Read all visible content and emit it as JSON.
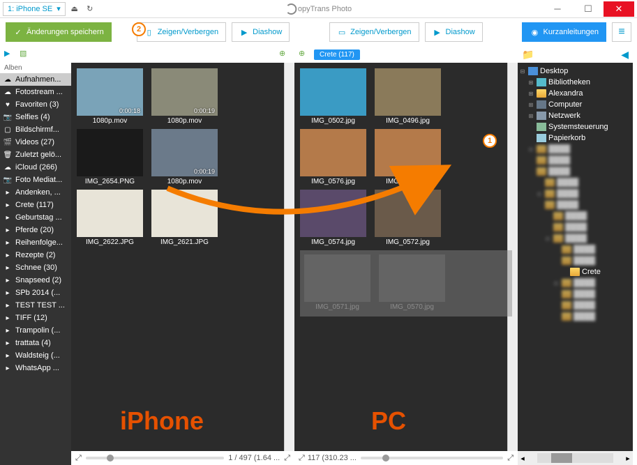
{
  "titlebar": {
    "device": "1: iPhone SE",
    "app_name": "opyTrans Photo"
  },
  "toolbar": {
    "save": "Änderungen speichern",
    "left_show": "Zeigen/Verbergen",
    "left_slide": "Diashow",
    "right_show": "Zeigen/Verbergen",
    "right_slide": "Diashow",
    "help": "Kurzanleitungen"
  },
  "sidebar": {
    "title": "Alben",
    "items": [
      {
        "icon": "☁",
        "label": "Aufnahmen..."
      },
      {
        "icon": "☁",
        "label": "Fotostream ..."
      },
      {
        "icon": "♥",
        "label": "Favoriten (3)"
      },
      {
        "icon": "📷",
        "label": "Selfies (4)"
      },
      {
        "icon": "▢",
        "label": "Bildschirmf..."
      },
      {
        "icon": "🎬",
        "label": "Videos (27)"
      },
      {
        "icon": "🗑",
        "label": "Zuletzt gelö..."
      },
      {
        "icon": "☁",
        "label": "iCloud (266)"
      },
      {
        "icon": "📷",
        "label": "Foto Mediat..."
      },
      {
        "icon": "▸",
        "label": "Andenken, ..."
      },
      {
        "icon": "▸",
        "label": "Crete (117)"
      },
      {
        "icon": "▸",
        "label": "Geburtstag ..."
      },
      {
        "icon": "▸",
        "label": "Pferde (20)"
      },
      {
        "icon": "▸",
        "label": "Reihenfolge..."
      },
      {
        "icon": "▸",
        "label": "Rezepte (2)"
      },
      {
        "icon": "▸",
        "label": "Schnee (30)"
      },
      {
        "icon": "▸",
        "label": "Snapseed (2)"
      },
      {
        "icon": "▸",
        "label": "SPb 2014 (..."
      },
      {
        "icon": "▸",
        "label": "TEST TEST ..."
      },
      {
        "icon": "▸",
        "label": "TIFF (12)"
      },
      {
        "icon": "▸",
        "label": "Trampolin (..."
      },
      {
        "icon": "▸",
        "label": "trattata (4)"
      },
      {
        "icon": "▸",
        "label": "Waldsteig (..."
      },
      {
        "icon": "▸",
        "label": "WhatsApp ..."
      }
    ]
  },
  "left_panel": {
    "thumbs": [
      [
        {
          "name": "1080p.mov",
          "dur": "0:00:18",
          "bg": "#7aa3b8"
        },
        {
          "name": "1080p.mov",
          "dur": "0:00:19",
          "bg": "#8a8a78"
        }
      ],
      [
        {
          "name": "IMG_2654.PNG",
          "bg": "#1a1a1a"
        },
        {
          "name": "1080p.mov",
          "dur": "0:00:19",
          "bg": "#6b7a8a"
        }
      ],
      [
        {
          "name": "IMG_2622.JPG",
          "bg": "#e8e4d8"
        },
        {
          "name": "IMG_2621.JPG",
          "bg": "#e8e4d8"
        }
      ]
    ],
    "status": "1 / 497 (1.64 ...",
    "big_label": "iPhone"
  },
  "right_panel": {
    "tag": "Crete (117)",
    "thumbs": [
      [
        {
          "name": "IMG_0502.jpg",
          "bg": "#3a9bc4"
        },
        {
          "name": "IMG_0496.jpg",
          "bg": "#8a7a5a"
        }
      ],
      [
        {
          "name": "IMG_0576.jpg",
          "bg": "#b47a4a"
        },
        {
          "name": "IMG_0575.jpg",
          "bg": "#b47a4a"
        }
      ],
      [
        {
          "name": "IMG_0574.jpg",
          "bg": "#5a4a6a"
        },
        {
          "name": "IMG_0572.jpg",
          "bg": "#6a5a4a"
        }
      ]
    ],
    "faded": [
      {
        "name": "IMG_0571.jpg"
      },
      {
        "name": "IMG_0570.jpg"
      }
    ],
    "status": "117 (310.23 ...",
    "big_label": "PC"
  },
  "tree": {
    "items": [
      {
        "icon": "desktop",
        "label": "Desktop",
        "indent": 0,
        "exp": "⊟"
      },
      {
        "icon": "lib",
        "label": "Bibliotheken",
        "indent": 1,
        "exp": "⊞"
      },
      {
        "icon": "folder",
        "label": "Alexandra",
        "indent": 1,
        "exp": "⊞"
      },
      {
        "icon": "comp",
        "label": "Computer",
        "indent": 1,
        "exp": "⊞"
      },
      {
        "icon": "net",
        "label": "Netzwerk",
        "indent": 1,
        "exp": "⊞"
      },
      {
        "icon": "ctrl",
        "label": "Systemsteuerung",
        "indent": 1,
        "exp": ""
      },
      {
        "icon": "trash",
        "label": "Papierkorb",
        "indent": 1,
        "exp": ""
      }
    ],
    "highlight": "Crete"
  },
  "badges": {
    "b1": "1",
    "b2": "2"
  }
}
